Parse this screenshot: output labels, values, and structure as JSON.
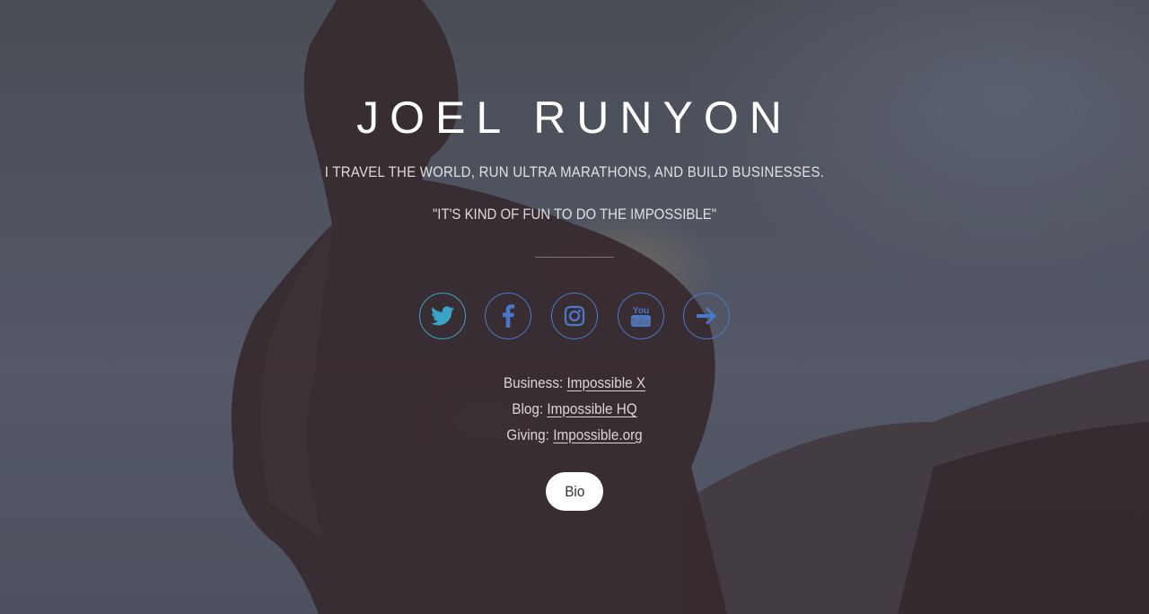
{
  "header": {
    "name": "JOEL RUNYON",
    "tagline": "I travel the world, run ultra marathons, and build businesses.",
    "quote": "\"It's kind of fun to do the impossible\""
  },
  "social": [
    {
      "icon": "twitter-icon",
      "color": "#3aa3c8"
    },
    {
      "icon": "facebook-icon",
      "color": "#4a78c8"
    },
    {
      "icon": "instagram-icon",
      "color": "#4a78c8"
    },
    {
      "icon": "youtube-icon",
      "color": "#4a78c8"
    },
    {
      "icon": "arrow-right-icon",
      "color": "#4a78c8"
    }
  ],
  "links": {
    "business_label": "Business:",
    "business_link": "Impossible X",
    "blog_label": "Blog:",
    "blog_link": "Impossible HQ",
    "giving_label": "Giving:",
    "giving_link": "Impossible.org"
  },
  "bio_button": "Bio"
}
